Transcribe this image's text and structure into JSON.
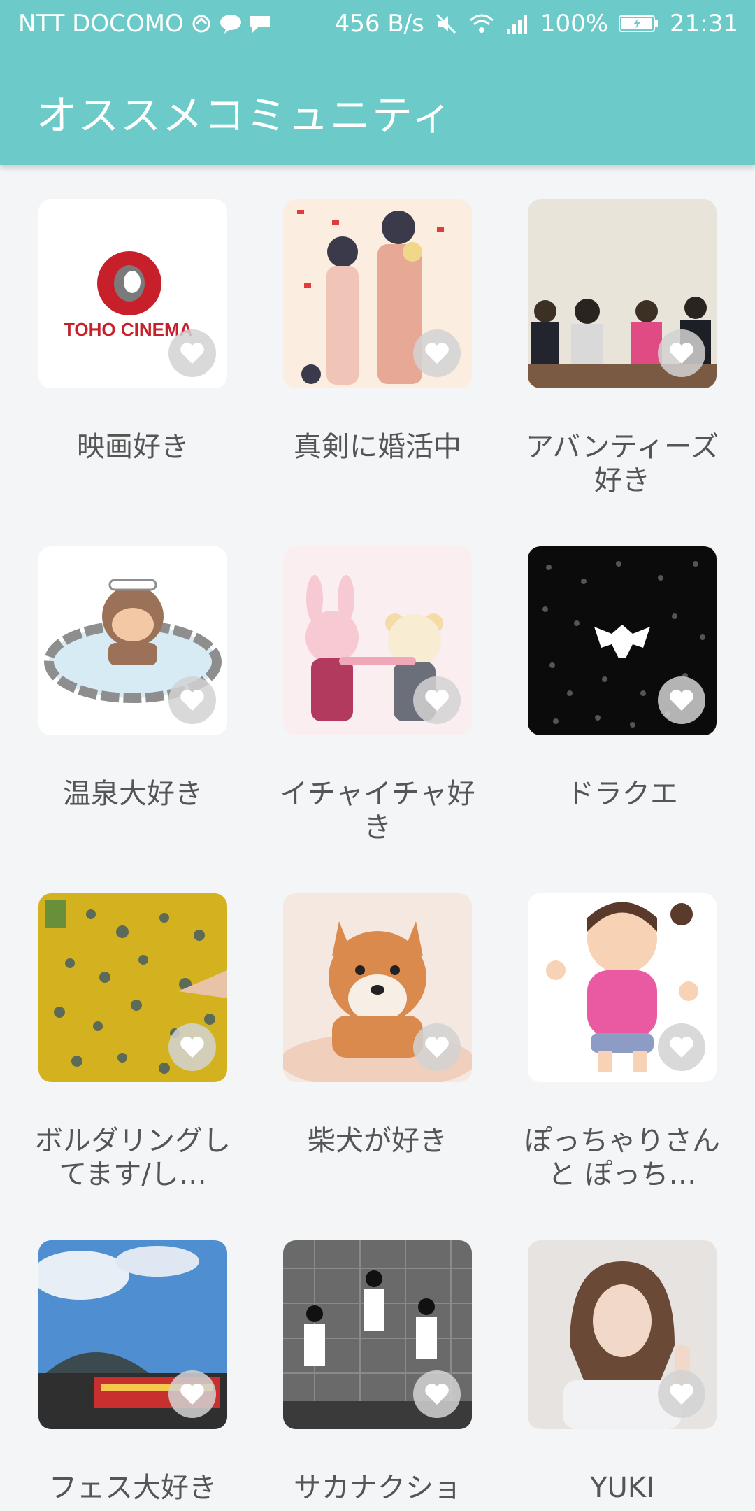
{
  "status_bar": {
    "carrier": "NTT DOCOMO",
    "net_speed": "456 B/s",
    "battery": "100%",
    "time": "21:31"
  },
  "header": {
    "title": "オススメコミュニティ"
  },
  "communities": [
    {
      "name": "映画好き",
      "thumb_text": "TOHO CINEMA"
    },
    {
      "name": "真剣に婚活中"
    },
    {
      "name": "アバンティーズ好き"
    },
    {
      "name": "温泉大好き"
    },
    {
      "name": "イチャイチャ好き"
    },
    {
      "name": "ドラクエ"
    },
    {
      "name": "ボルダリングしてます/し…"
    },
    {
      "name": "柴犬が好き"
    },
    {
      "name": "ぽっちゃりさん と ぽっち…"
    },
    {
      "name": "フェス大好き"
    },
    {
      "name": "サカナクショ"
    },
    {
      "name": "YUKI"
    }
  ],
  "colors": {
    "accent": "#6ccbc9",
    "background": "#f3f5f7",
    "label": "#555555"
  }
}
